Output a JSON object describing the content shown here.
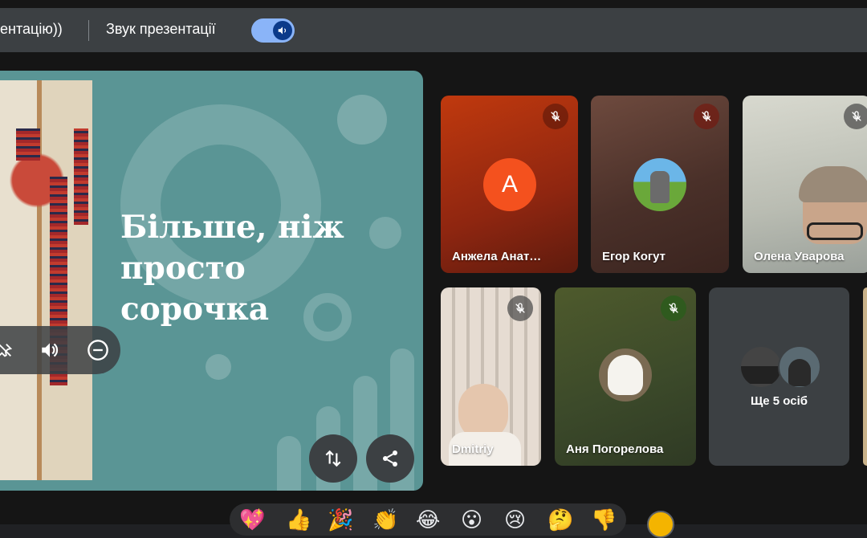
{
  "toolbar": {
    "left_text": "ентацію))",
    "sound_label": "Звук презентації",
    "sound_toggle_on": true
  },
  "slide": {
    "title": "Більше, ніж просто сорочка"
  },
  "participants": [
    {
      "name": "Анжела Анат…",
      "avatar_letter": "A",
      "avatar_color": "#f4511e",
      "muted": true
    },
    {
      "name": "Егор Когут",
      "muted": true
    },
    {
      "name": "Олена Уварова",
      "muted": true
    },
    {
      "name": "Dmitriy",
      "muted": true
    },
    {
      "name": "Аня Погорелова",
      "muted": true
    }
  ],
  "more": {
    "label": "Ще 5 осіб"
  },
  "reactions": [
    "💖",
    "👍",
    "🎉",
    "👏",
    "😂",
    "😮",
    "😢",
    "🤔",
    "👎"
  ],
  "colors": {
    "accent": "#8ab4f8",
    "slide_bg": "#5a9595",
    "background": "#151515"
  }
}
